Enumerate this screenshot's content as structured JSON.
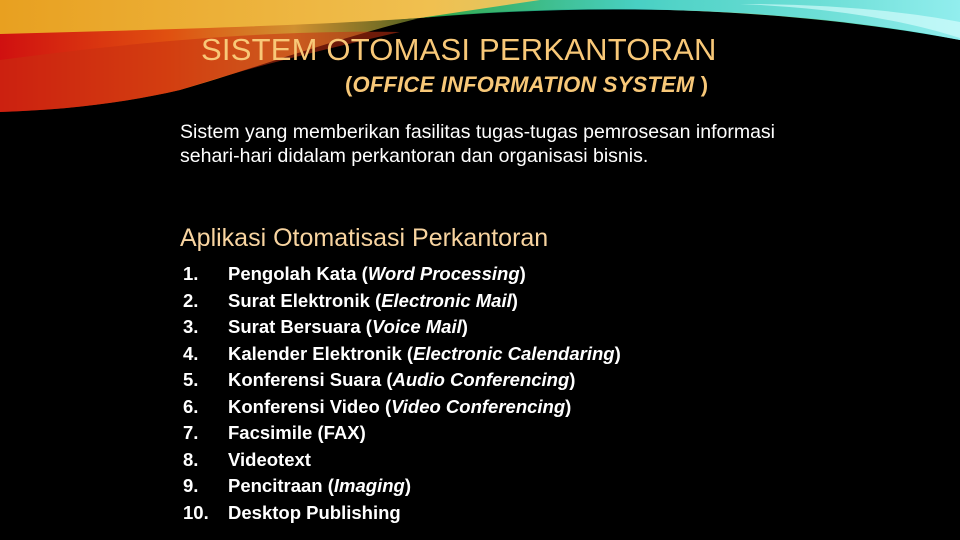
{
  "slide": {
    "title": "SISTEM OTOMASI PERKANTORAN",
    "subtitle_open": "(",
    "subtitle_italic": "OFFICE INFORMATION SYSTEM",
    "subtitle_close": " )",
    "description": "Sistem yang memberikan fasilitas tugas-tugas pemrosesan informasi sehari-hari didalam perkantoran dan organisasi bisnis.",
    "section_heading": "Aplikasi Otomatisasi Perkantoran",
    "applications": [
      {
        "number": "1.",
        "name": "Pengolah Kata (",
        "english": "Word Processing",
        "close": ")"
      },
      {
        "number": "2.",
        "name": "Surat Elektronik (",
        "english": "Electronic Mail",
        "close": ")"
      },
      {
        "number": "3.",
        "name": "Surat Bersuara (",
        "english": "Voice Mail",
        "close": ")"
      },
      {
        "number": "4.",
        "name": "Kalender Elektronik (",
        "english": "Electronic Calendaring",
        "close": ")"
      },
      {
        "number": "5.",
        "name": "Konferensi Suara (",
        "english": "Audio Conferencing",
        "close": ")"
      },
      {
        "number": "6.",
        "name": "Konferensi Video (",
        "english": "Video Conferencing",
        "close": ")"
      },
      {
        "number": "7.",
        "name": "Facsimile (FAX)",
        "english": "",
        "close": ""
      },
      {
        "number": "8.",
        "name": "Videotext",
        "english": "",
        "close": ""
      },
      {
        "number": "9.",
        "name": "Pencitraan (",
        "english": "Imaging",
        "close": ")"
      },
      {
        "number": "10.",
        "name": "Desktop Publishing",
        "english": "",
        "close": ""
      }
    ]
  },
  "theme": {
    "background": "#000000",
    "title_color": "#f8c878",
    "heading_color": "#f8d4a0",
    "text_color": "#ffffff"
  }
}
